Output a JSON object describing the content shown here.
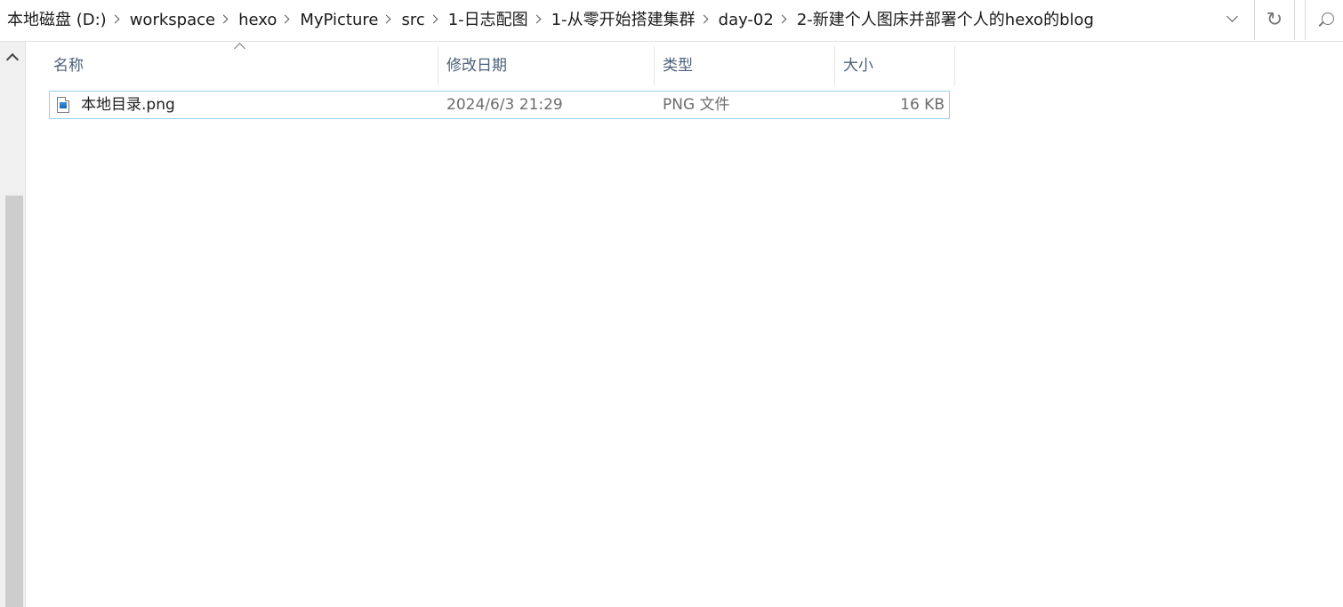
{
  "address": {
    "crumbs": [
      "本地磁盘 (D:)",
      "workspace",
      "hexo",
      "MyPicture",
      "src",
      "1-日志配图",
      "1-从零开始搭建集群",
      "day-02",
      "2-新建个人图床并部署个人的hexo的blog"
    ],
    "refresh_glyph": "↻"
  },
  "columns": {
    "name": "名称",
    "modified": "修改日期",
    "type": "类型",
    "size": "大小"
  },
  "files": [
    {
      "name": "本地目录.png",
      "modified": "2024/6/3 21:29",
      "type": "PNG 文件",
      "size": "16 KB",
      "icon": "png-image-file-icon"
    }
  ]
}
